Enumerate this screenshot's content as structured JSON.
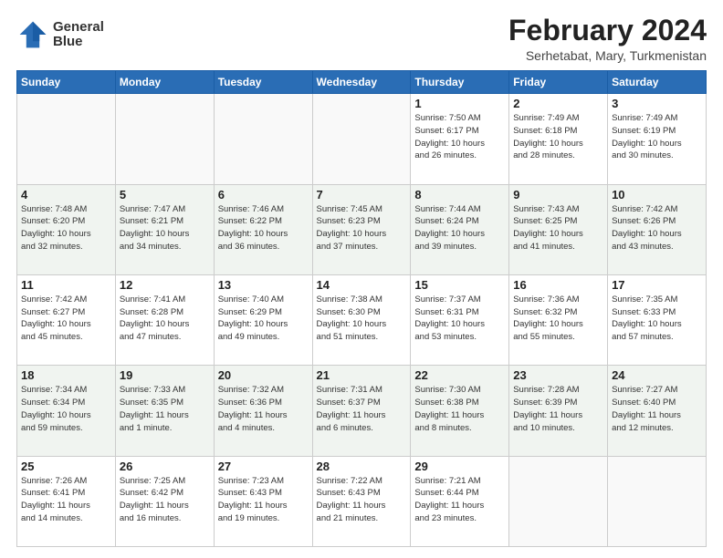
{
  "header": {
    "logo": {
      "general": "General",
      "blue": "Blue"
    },
    "title": "February 2024",
    "subtitle": "Serhetabat, Mary, Turkmenistan"
  },
  "weekdays": [
    "Sunday",
    "Monday",
    "Tuesday",
    "Wednesday",
    "Thursday",
    "Friday",
    "Saturday"
  ],
  "weeks": [
    [
      {
        "day": "",
        "info": ""
      },
      {
        "day": "",
        "info": ""
      },
      {
        "day": "",
        "info": ""
      },
      {
        "day": "",
        "info": ""
      },
      {
        "day": "1",
        "info": "Sunrise: 7:50 AM\nSunset: 6:17 PM\nDaylight: 10 hours\nand 26 minutes."
      },
      {
        "day": "2",
        "info": "Sunrise: 7:49 AM\nSunset: 6:18 PM\nDaylight: 10 hours\nand 28 minutes."
      },
      {
        "day": "3",
        "info": "Sunrise: 7:49 AM\nSunset: 6:19 PM\nDaylight: 10 hours\nand 30 minutes."
      }
    ],
    [
      {
        "day": "4",
        "info": "Sunrise: 7:48 AM\nSunset: 6:20 PM\nDaylight: 10 hours\nand 32 minutes."
      },
      {
        "day": "5",
        "info": "Sunrise: 7:47 AM\nSunset: 6:21 PM\nDaylight: 10 hours\nand 34 minutes."
      },
      {
        "day": "6",
        "info": "Sunrise: 7:46 AM\nSunset: 6:22 PM\nDaylight: 10 hours\nand 36 minutes."
      },
      {
        "day": "7",
        "info": "Sunrise: 7:45 AM\nSunset: 6:23 PM\nDaylight: 10 hours\nand 37 minutes."
      },
      {
        "day": "8",
        "info": "Sunrise: 7:44 AM\nSunset: 6:24 PM\nDaylight: 10 hours\nand 39 minutes."
      },
      {
        "day": "9",
        "info": "Sunrise: 7:43 AM\nSunset: 6:25 PM\nDaylight: 10 hours\nand 41 minutes."
      },
      {
        "day": "10",
        "info": "Sunrise: 7:42 AM\nSunset: 6:26 PM\nDaylight: 10 hours\nand 43 minutes."
      }
    ],
    [
      {
        "day": "11",
        "info": "Sunrise: 7:42 AM\nSunset: 6:27 PM\nDaylight: 10 hours\nand 45 minutes."
      },
      {
        "day": "12",
        "info": "Sunrise: 7:41 AM\nSunset: 6:28 PM\nDaylight: 10 hours\nand 47 minutes."
      },
      {
        "day": "13",
        "info": "Sunrise: 7:40 AM\nSunset: 6:29 PM\nDaylight: 10 hours\nand 49 minutes."
      },
      {
        "day": "14",
        "info": "Sunrise: 7:38 AM\nSunset: 6:30 PM\nDaylight: 10 hours\nand 51 minutes."
      },
      {
        "day": "15",
        "info": "Sunrise: 7:37 AM\nSunset: 6:31 PM\nDaylight: 10 hours\nand 53 minutes."
      },
      {
        "day": "16",
        "info": "Sunrise: 7:36 AM\nSunset: 6:32 PM\nDaylight: 10 hours\nand 55 minutes."
      },
      {
        "day": "17",
        "info": "Sunrise: 7:35 AM\nSunset: 6:33 PM\nDaylight: 10 hours\nand 57 minutes."
      }
    ],
    [
      {
        "day": "18",
        "info": "Sunrise: 7:34 AM\nSunset: 6:34 PM\nDaylight: 10 hours\nand 59 minutes."
      },
      {
        "day": "19",
        "info": "Sunrise: 7:33 AM\nSunset: 6:35 PM\nDaylight: 11 hours\nand 1 minute."
      },
      {
        "day": "20",
        "info": "Sunrise: 7:32 AM\nSunset: 6:36 PM\nDaylight: 11 hours\nand 4 minutes."
      },
      {
        "day": "21",
        "info": "Sunrise: 7:31 AM\nSunset: 6:37 PM\nDaylight: 11 hours\nand 6 minutes."
      },
      {
        "day": "22",
        "info": "Sunrise: 7:30 AM\nSunset: 6:38 PM\nDaylight: 11 hours\nand 8 minutes."
      },
      {
        "day": "23",
        "info": "Sunrise: 7:28 AM\nSunset: 6:39 PM\nDaylight: 11 hours\nand 10 minutes."
      },
      {
        "day": "24",
        "info": "Sunrise: 7:27 AM\nSunset: 6:40 PM\nDaylight: 11 hours\nand 12 minutes."
      }
    ],
    [
      {
        "day": "25",
        "info": "Sunrise: 7:26 AM\nSunset: 6:41 PM\nDaylight: 11 hours\nand 14 minutes."
      },
      {
        "day": "26",
        "info": "Sunrise: 7:25 AM\nSunset: 6:42 PM\nDaylight: 11 hours\nand 16 minutes."
      },
      {
        "day": "27",
        "info": "Sunrise: 7:23 AM\nSunset: 6:43 PM\nDaylight: 11 hours\nand 19 minutes."
      },
      {
        "day": "28",
        "info": "Sunrise: 7:22 AM\nSunset: 6:43 PM\nDaylight: 11 hours\nand 21 minutes."
      },
      {
        "day": "29",
        "info": "Sunrise: 7:21 AM\nSunset: 6:44 PM\nDaylight: 11 hours\nand 23 minutes."
      },
      {
        "day": "",
        "info": ""
      },
      {
        "day": "",
        "info": ""
      }
    ]
  ]
}
